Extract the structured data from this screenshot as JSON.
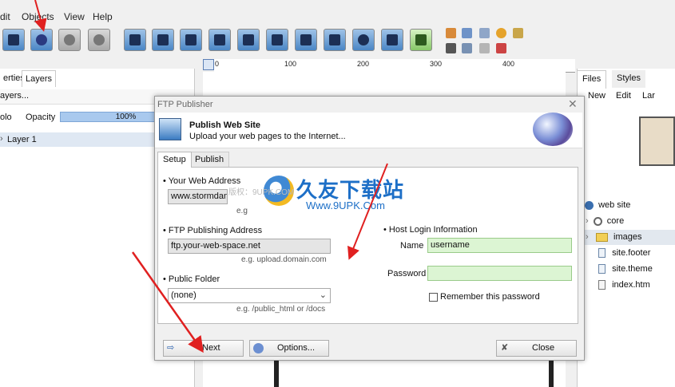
{
  "menu": [
    "dit",
    "Objects",
    "View",
    "Help"
  ],
  "left_panel": {
    "tabs": [
      "erties",
      "Layers"
    ],
    "layers_row": "ayers...",
    "solo_label": "olo",
    "opacity_label": "Opacity",
    "opacity_value": "100%",
    "layer_item": "Layer 1"
  },
  "ruler": {
    "marks": [
      "0",
      "100",
      "200",
      "300",
      "400"
    ]
  },
  "right_panel": {
    "tabs": [
      "Files",
      "Styles"
    ],
    "toolbar": [
      "New",
      "Edit",
      "Lar"
    ],
    "tree": [
      {
        "label": "web site",
        "icon": "globe-icon"
      },
      {
        "label": "core",
        "icon": "core-folder-icon"
      },
      {
        "label": "images",
        "icon": "folder-icon"
      },
      {
        "label": "site.footer",
        "icon": "file-icon"
      },
      {
        "label": "site.theme",
        "icon": "file-icon"
      },
      {
        "label": "index.htm",
        "icon": "file-icon"
      }
    ]
  },
  "dialog": {
    "title": "FTP Publisher",
    "close": "✕",
    "header_title": "Publish Web Site",
    "header_subtitle": "Upload your web pages to the Internet...",
    "tabs": [
      "Setup",
      "Publish"
    ],
    "web_address_label": "• Your Web Address",
    "web_address_value": "www.stormdance.n",
    "web_address_hint": "e.g",
    "ftp_label": "• FTP Publishing Address",
    "ftp_value": "ftp.your-web-space.net",
    "ftp_hint": "e.g. upload.domain.com",
    "folder_label": "• Public Folder",
    "folder_value": "(none)",
    "folder_hint": "e.g. /public_html or /docs",
    "host_label": "• Host Login Information",
    "name_label": "Name",
    "name_value": "username",
    "password_label": "Password",
    "password_value": "",
    "remember_label": "Remember this password",
    "buttons": {
      "next": "Next",
      "options": "Options...",
      "close": "Close"
    }
  },
  "watermark": {
    "title": "久友下载站",
    "url": "Www.9UPK.Com",
    "sub": "版权：9UPK.COM"
  },
  "colors": {
    "annotation_arrow": "#e02020",
    "field_green": "#dcf5d3",
    "accent_blue": "#1d6fc7"
  }
}
